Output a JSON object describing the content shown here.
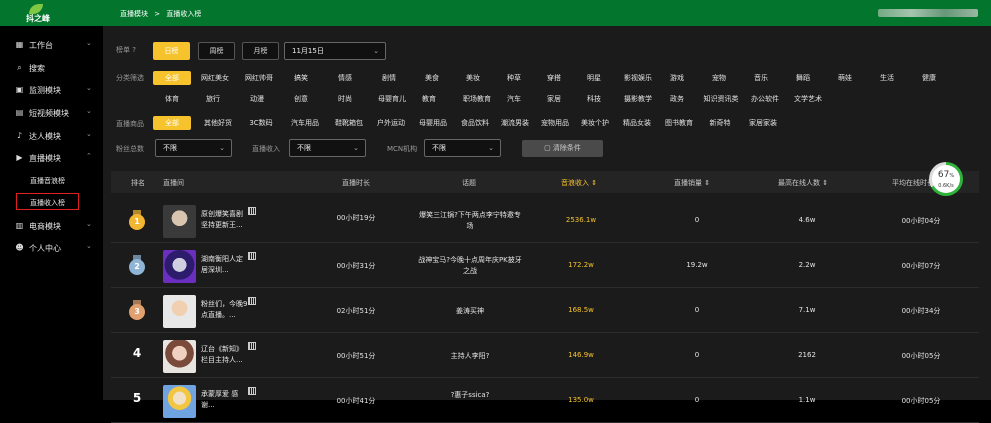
{
  "header": {
    "logo_text": "抖之峰",
    "breadcrumb": [
      "直播模块",
      ">",
      "直播收入榜"
    ]
  },
  "sidebar": {
    "items": [
      {
        "label": "工作台",
        "icon": "grid-icon",
        "chevron": "⌄"
      },
      {
        "label": "搜索",
        "icon": "search-icon",
        "chevron": ""
      },
      {
        "label": "监测模块",
        "icon": "monitor-icon",
        "chevron": "⌄"
      },
      {
        "label": "短视频模块",
        "icon": "video-icon",
        "chevron": "⌄"
      },
      {
        "label": "达人模块",
        "icon": "tiktok-icon",
        "chevron": "⌄"
      },
      {
        "label": "直播模块",
        "icon": "live-icon",
        "chevron": "⌃"
      },
      {
        "label": "电商模块",
        "icon": "shop-icon",
        "chevron": "⌄"
      },
      {
        "label": "个人中心",
        "icon": "user-icon",
        "chevron": "⌄"
      }
    ],
    "sub_items": [
      "直播音浪榜",
      "直播收入榜"
    ]
  },
  "filters": {
    "rank_label": "榜单",
    "period_buttons": [
      "日榜",
      "周榜",
      "月榜"
    ],
    "date_value": "11月15日",
    "category_label": "分类筛选",
    "categories_row1": [
      "全部",
      "网红美女",
      "网红帅哥",
      "搞笑",
      "情感",
      "剧情",
      "美食",
      "美妆",
      "种草",
      "穿搭",
      "明星",
      "影视娱乐",
      "游戏",
      "宠物",
      "音乐",
      "舞蹈",
      "萌娃",
      "生活",
      "健康"
    ],
    "categories_row2": [
      "体育",
      "旅行",
      "动漫",
      "创意",
      "时尚",
      "母婴育儿",
      "教育",
      "职场教育",
      "汽车",
      "家居",
      "科技",
      "摄影教学",
      "政务",
      "知识资讯类",
      "办公软件",
      "文学艺术"
    ],
    "goods_label": "直播商品",
    "goods": [
      "全部",
      "其他好货",
      "3C数码",
      "汽车用品",
      "鞋靴箱包",
      "户外运动",
      "母婴用品",
      "食品饮料",
      "潮流男装",
      "宠物用品",
      "美妆个护",
      "精品女装",
      "图书教育",
      "新奇特",
      "家居家装"
    ],
    "fans_label": "粉丝总数",
    "fans_value": "不限",
    "income_label": "直播收入",
    "income_value": "不限",
    "mcn_label": "MCN机构",
    "mcn_value": "不限",
    "clear_label": "清除条件"
  },
  "table": {
    "columns": [
      "排名",
      "直播间",
      "直播时长",
      "话题",
      "音浪收入 ⇕",
      "直播销量 ⇕",
      "最高在线人数 ⇕",
      "平均在线时长"
    ],
    "rows": [
      {
        "rank": "1",
        "medal_color": "#f2b632",
        "name": "原创爆笑喜剧坚持更新王...",
        "duration": "00小时19分",
        "topic": "爆笑三江锅?下午两点李宁特邀专场",
        "income": "2536.1w",
        "sales": "0",
        "peak": "4.6w",
        "avg": "00小时04分"
      },
      {
        "rank": "2",
        "medal_color": "#8fb4d6",
        "name": "湖南衡阳人定居深圳...",
        "duration": "00小时31分",
        "topic": "战神宝马?今晚十点周年庆PK披牙之战",
        "income": "172.2w",
        "sales": "19.2w",
        "peak": "2.2w",
        "avg": "00小时07分"
      },
      {
        "rank": "3",
        "medal_color": "#e0a070",
        "name": "粉丝们，今晚9点直播。...",
        "duration": "02小时51分",
        "topic": "姜涛买神",
        "income": "168.5w",
        "sales": "0",
        "peak": "7.1w",
        "avg": "00小时34分"
      },
      {
        "rank": "4",
        "medal_color": "",
        "name": "辽台《新知》栏目主持人...",
        "duration": "00小时51分",
        "topic": "主持人李阳?",
        "income": "146.9w",
        "sales": "0",
        "peak": "2162",
        "avg": "00小时05分"
      },
      {
        "rank": "5",
        "medal_color": "",
        "name": "承蒙厚爱 感谢...",
        "duration": "00小时41分",
        "topic": "?惠子ssica?",
        "income": "135.0w",
        "sales": "0",
        "peak": "1.1w",
        "avg": "00小时05分"
      }
    ]
  },
  "speed_widget": {
    "percent": "67",
    "percent_value": 0.67,
    "unit": "%",
    "speed": "0.6K/s"
  },
  "colors": {
    "header": "#03752c",
    "accent": "#f6c32c",
    "bg": "#1b1b1b"
  }
}
